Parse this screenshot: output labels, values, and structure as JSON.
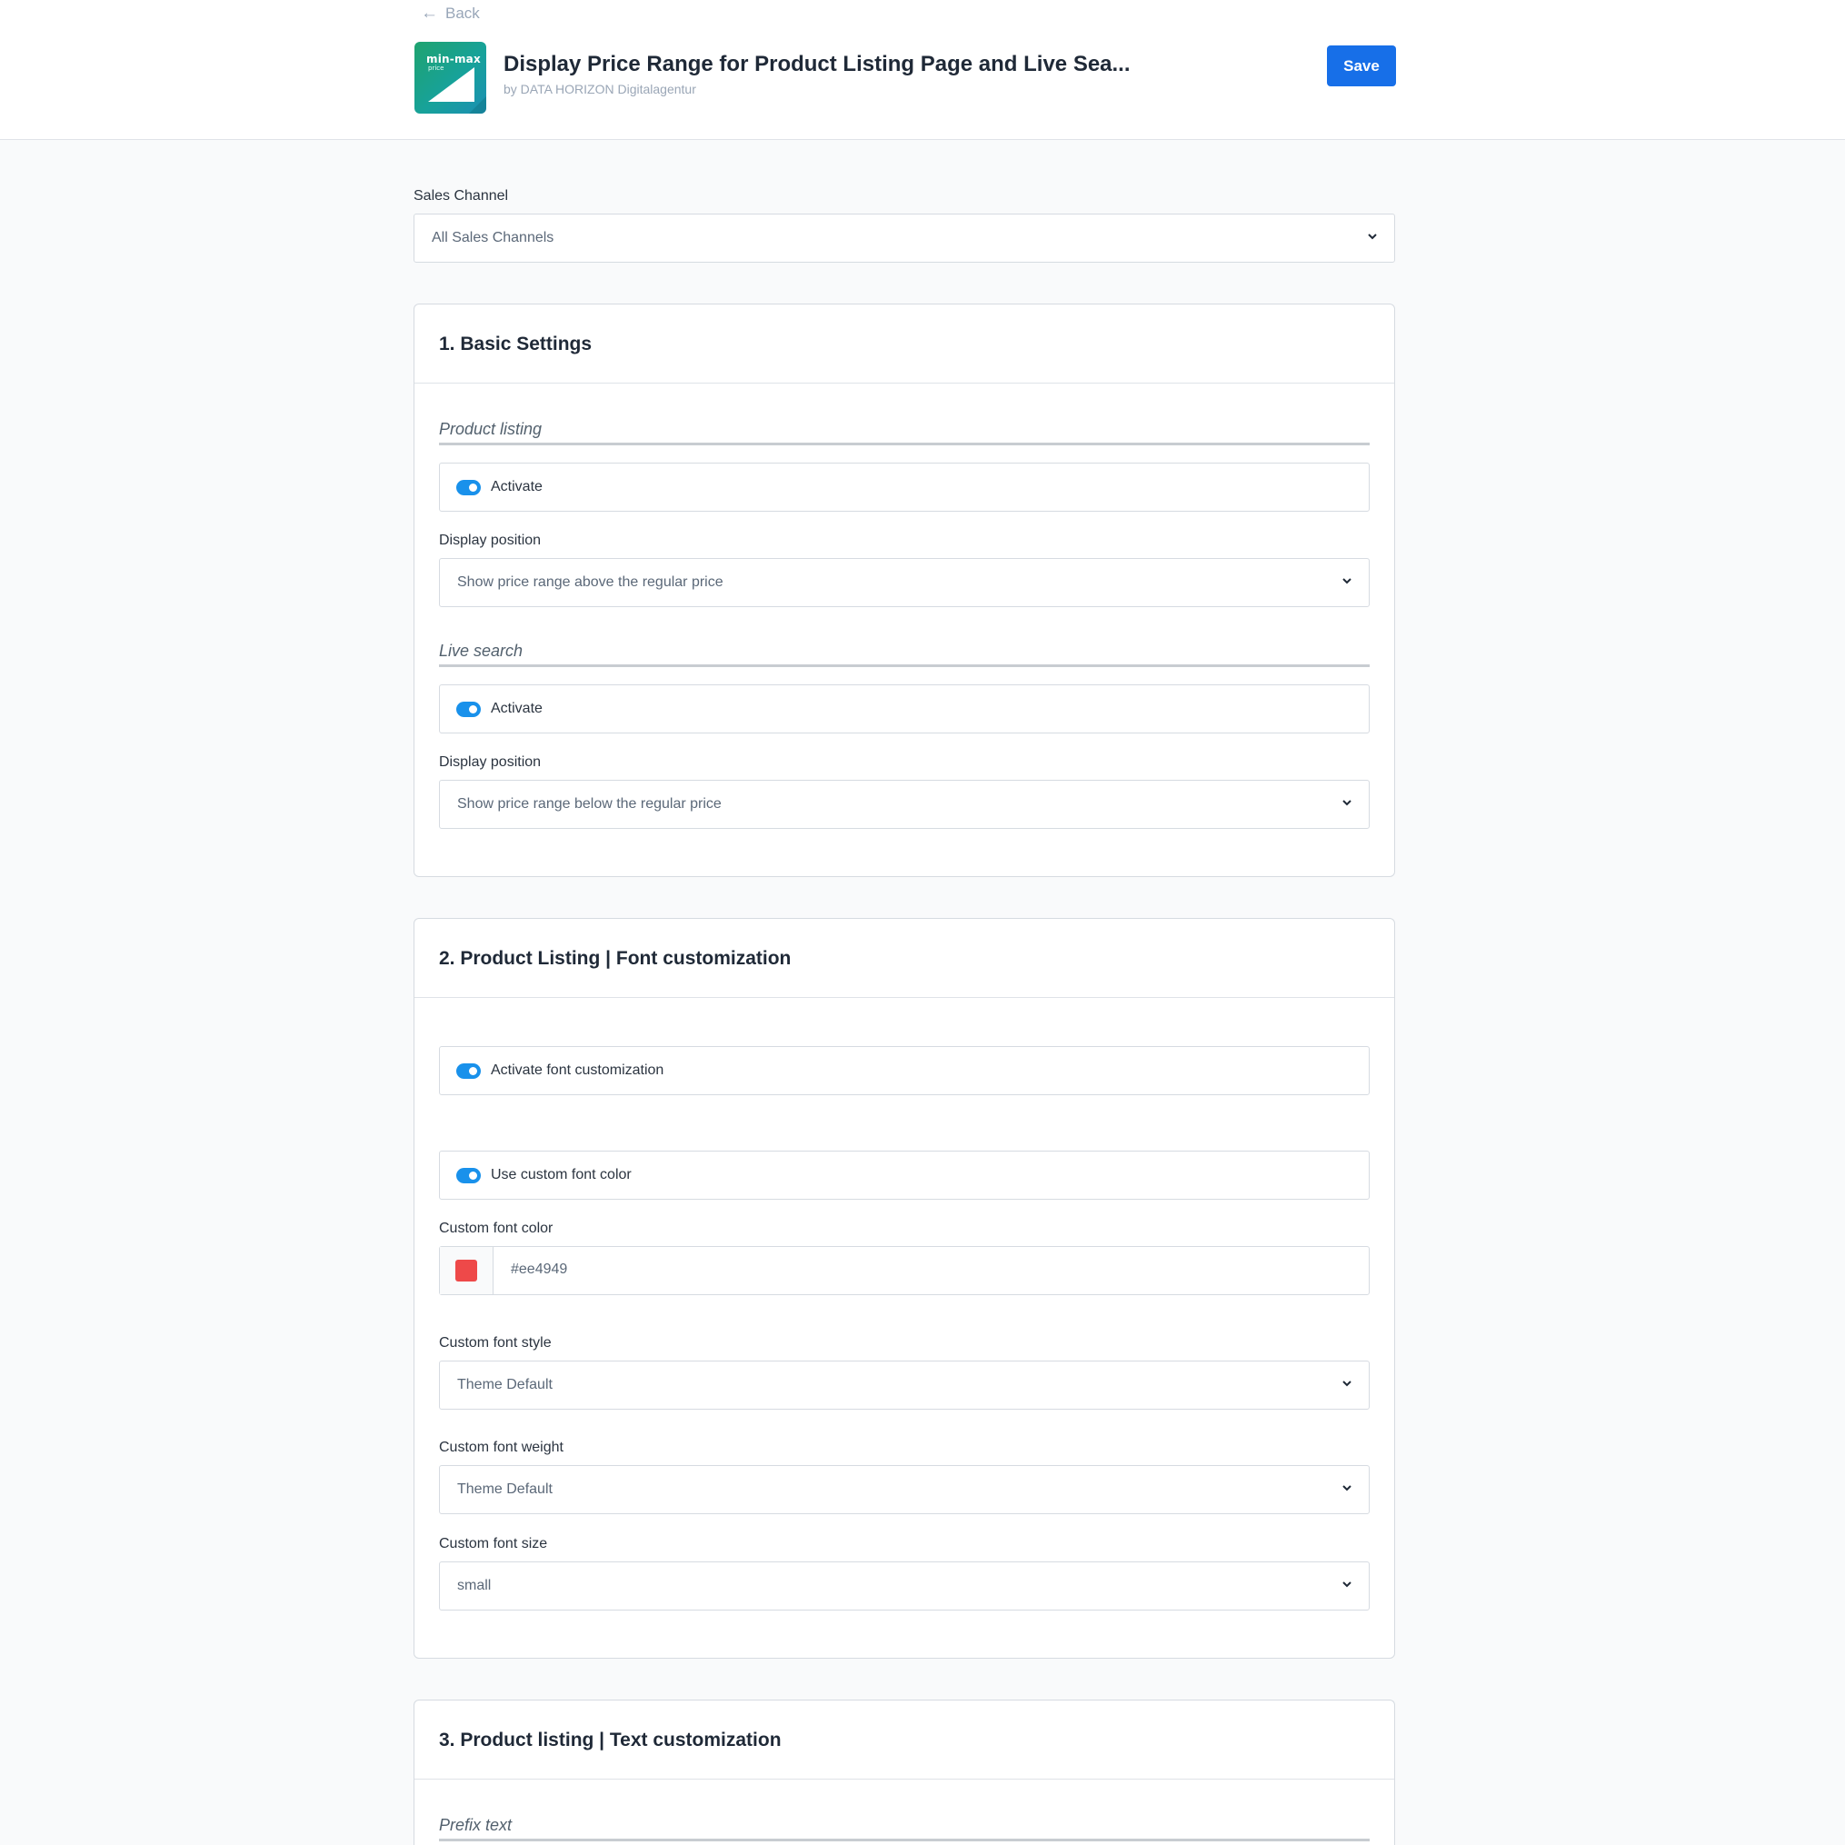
{
  "header": {
    "back_label": "Back",
    "logo_text": "min-max",
    "logo_subtext": "price",
    "app_title": "Display Price Range for Product Listing Page and Live Sea...",
    "vendor": "by DATA HORIZON Digitalagentur",
    "save_label": "Save"
  },
  "sales_channel": {
    "label": "Sales Channel",
    "value": "All Sales Channels"
  },
  "card1": {
    "title": "1. Basic Settings",
    "product_listing": {
      "section_title": "Product listing",
      "activate_label": "Activate",
      "activate_on": true,
      "position_label": "Display position",
      "position_value": "Show price range above the regular price"
    },
    "live_search": {
      "section_title": "Live search",
      "activate_label": "Activate",
      "activate_on": true,
      "position_label": "Display position",
      "position_value": "Show price range below the regular price"
    }
  },
  "card2": {
    "title": "2. Product Listing | Font customization",
    "font_custom_label": "Activate font customization",
    "font_custom_on": true,
    "custom_color_toggle_label": "Use custom font color",
    "custom_color_toggle_on": true,
    "color_label": "Custom font color",
    "color_value": "#ee4949",
    "style_label": "Custom font style",
    "style_value": "Theme Default",
    "weight_label": "Custom font weight",
    "weight_value": "Theme Default",
    "size_label": "Custom font size",
    "size_value": "small"
  },
  "card3": {
    "title": "3. Product listing | Text customization",
    "prefix_section_title": "Prefix text"
  },
  "colors": {
    "accent": "#176fe8",
    "toggle_on": "#1991eb",
    "swatch": "#ee4949"
  },
  "icons": {
    "back": "arrow-left-icon",
    "chevron": "chevron-down-icon"
  }
}
